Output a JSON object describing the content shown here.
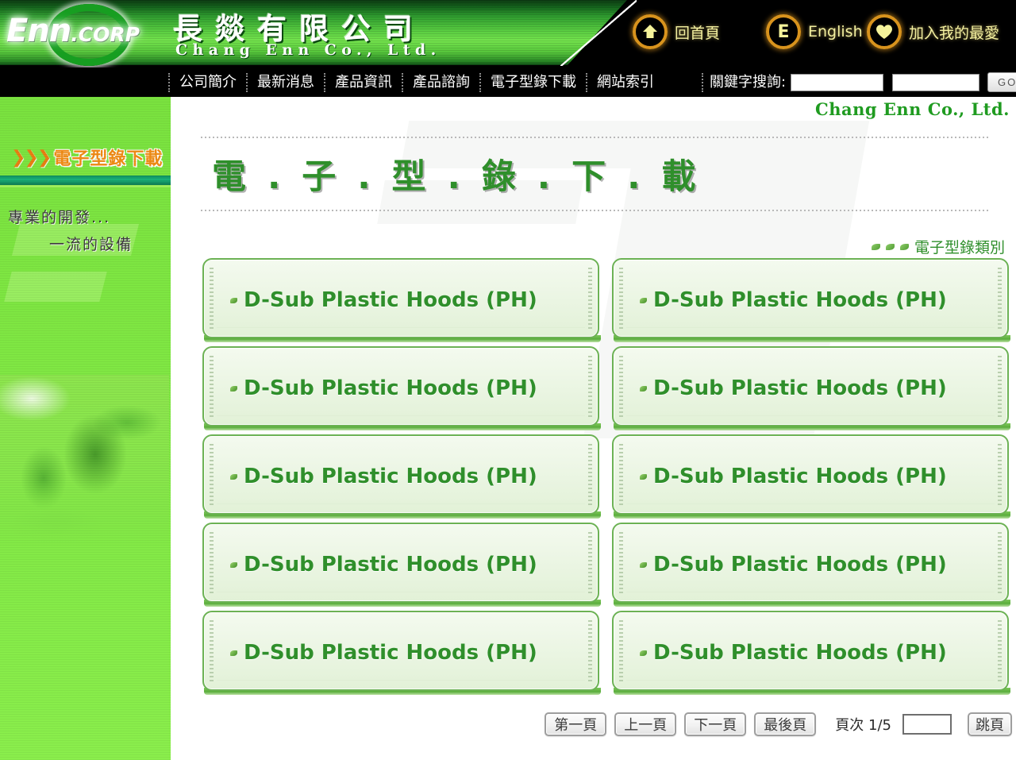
{
  "header": {
    "company_cn": "長燚有限公司",
    "company_en": "Chang Enn Co., Ltd.",
    "logo_main": "Enn",
    "logo_sub": ".CORP",
    "links": [
      {
        "icon": "home-icon",
        "glyph": "⬆",
        "label": "回首頁"
      },
      {
        "icon": "english-icon",
        "glyph": "E",
        "label": "English"
      },
      {
        "icon": "heart-icon",
        "glyph": "♥",
        "label": "加入我的最愛"
      }
    ]
  },
  "nav": {
    "items": [
      "公司簡介",
      "最新消息",
      "產品資訊",
      "產品諮詢",
      "電子型錄下載",
      "網站索引"
    ],
    "search_label": "關鍵字搜詢:",
    "search_value_1": "",
    "search_placeholder_1": "",
    "search_value_2": "",
    "search_placeholder_2": "",
    "go_label": "GO"
  },
  "sidebar": {
    "banner_chevrons": "❯❯❯",
    "banner_title": "電子型錄下載",
    "tagline_line1": "專業的開發...",
    "tagline_line2": "一流的設備"
  },
  "content": {
    "brand_en": "Chang Enn Co., Ltd.",
    "page_title": "電 . 子 . 型 . 錄 . 下 . 載",
    "category_label": "電子型錄類別",
    "cards": [
      {
        "label": "D-Sub Plastic Hoods (PH)"
      },
      {
        "label": "D-Sub Plastic Hoods (PH)"
      },
      {
        "label": "D-Sub Plastic Hoods (PH)"
      },
      {
        "label": "D-Sub Plastic Hoods (PH)"
      },
      {
        "label": "D-Sub Plastic Hoods (PH)"
      },
      {
        "label": "D-Sub Plastic Hoods (PH)"
      },
      {
        "label": "D-Sub Plastic Hoods (PH)"
      },
      {
        "label": "D-Sub Plastic Hoods (PH)"
      },
      {
        "label": "D-Sub Plastic Hoods (PH)"
      },
      {
        "label": "D-Sub Plastic Hoods (PH)"
      }
    ]
  },
  "pagination": {
    "first": "第一頁",
    "prev": "上一頁",
    "next": "下一頁",
    "last": "最後頁",
    "status": "頁次 1/5",
    "jump_value": "",
    "jump_placeholder": "",
    "jump": "跳頁"
  },
  "colors": {
    "brand_green": "#2f8f2b",
    "sidebar_green": "#7ee642",
    "accent_orange": "#ef8b14",
    "icon_ring": "#d8931d",
    "icon_glyph": "#f5f39a",
    "card_border": "#6cb254"
  }
}
